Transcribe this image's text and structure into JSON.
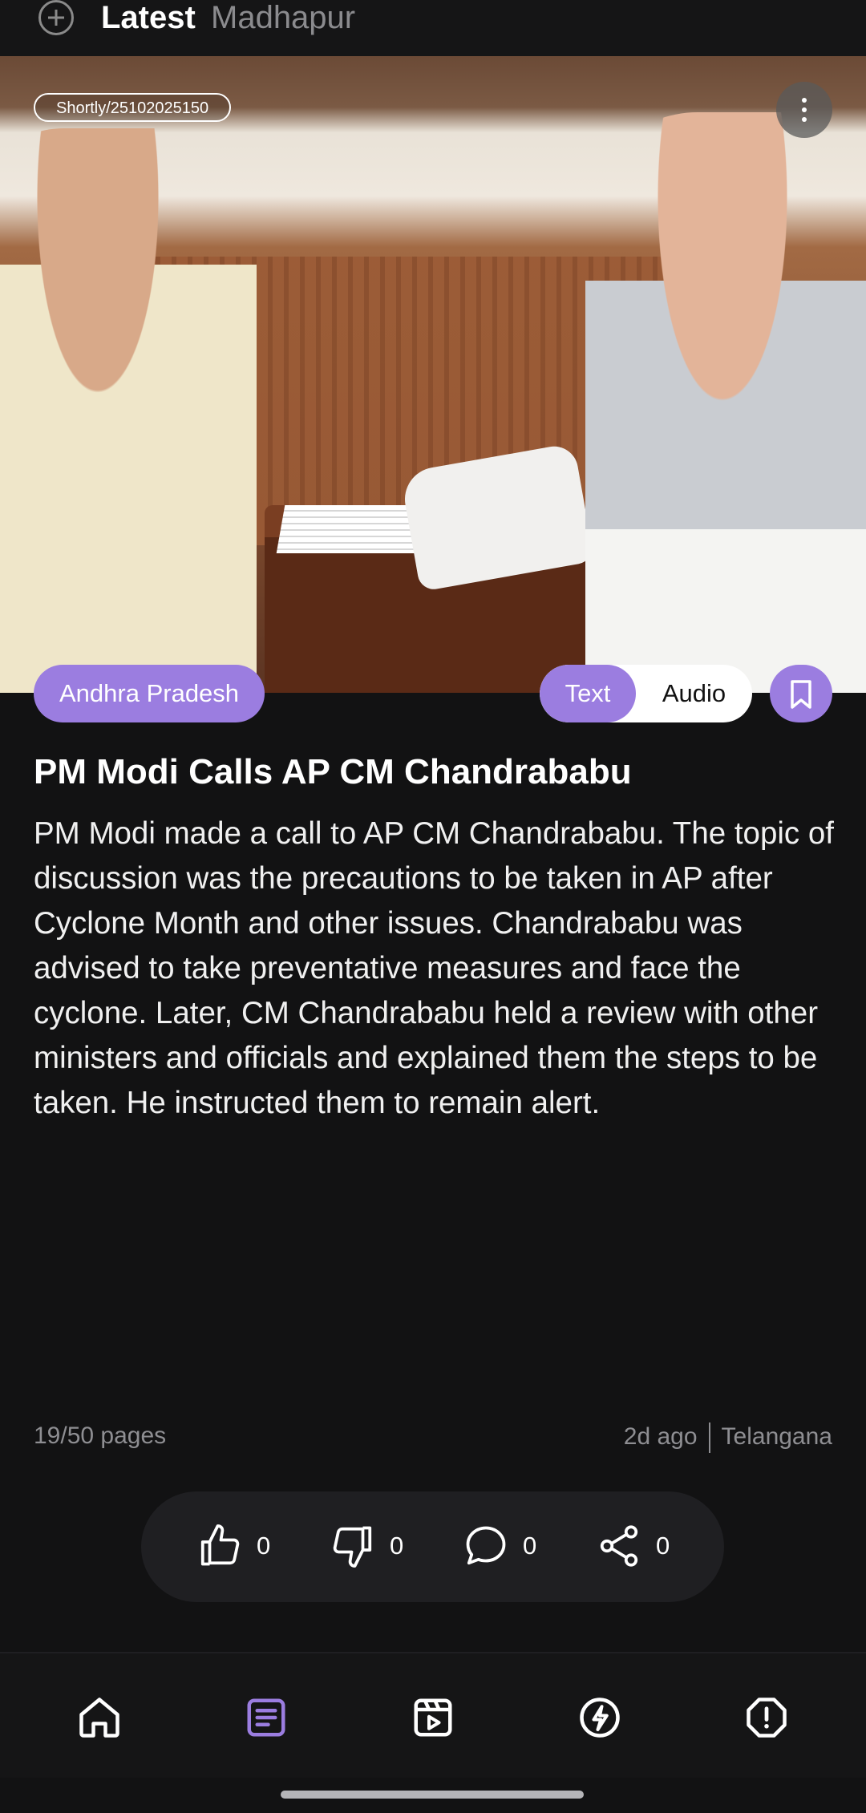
{
  "top_tabs": {
    "latest": "Latest",
    "location": "Madhapur"
  },
  "article": {
    "image_id_badge": "Shortly/25102025150",
    "category": "Andhra Pradesh",
    "mode_toggle": {
      "text": "Text",
      "audio": "Audio",
      "selected": "Text"
    },
    "headline": "PM Modi Calls AP CM Chandrababu",
    "body": "PM Modi made a call to AP CM Chandrababu. The topic of discussion was the precautions to be taken in AP after Cyclone Month and other issues. Chandrababu was advised to take preventative measures and face the cyclone. Later, CM Chandrababu held a review with other ministers and officials and explained them the steps to be taken. He instructed them to remain alert.",
    "pages": "19/50 pages",
    "time_ago": "2d ago",
    "region": "Telangana"
  },
  "reactions": {
    "likes": "0",
    "dislikes": "0",
    "comments": "0",
    "shares": "0"
  },
  "bottom_nav": {
    "items": [
      "home-icon",
      "article-icon",
      "video-icon",
      "flash-icon",
      "alert-icon"
    ],
    "active": "article-icon"
  },
  "colors": {
    "accent": "#9b7de0",
    "background": "#121213",
    "muted_text": "#8e8e92"
  }
}
